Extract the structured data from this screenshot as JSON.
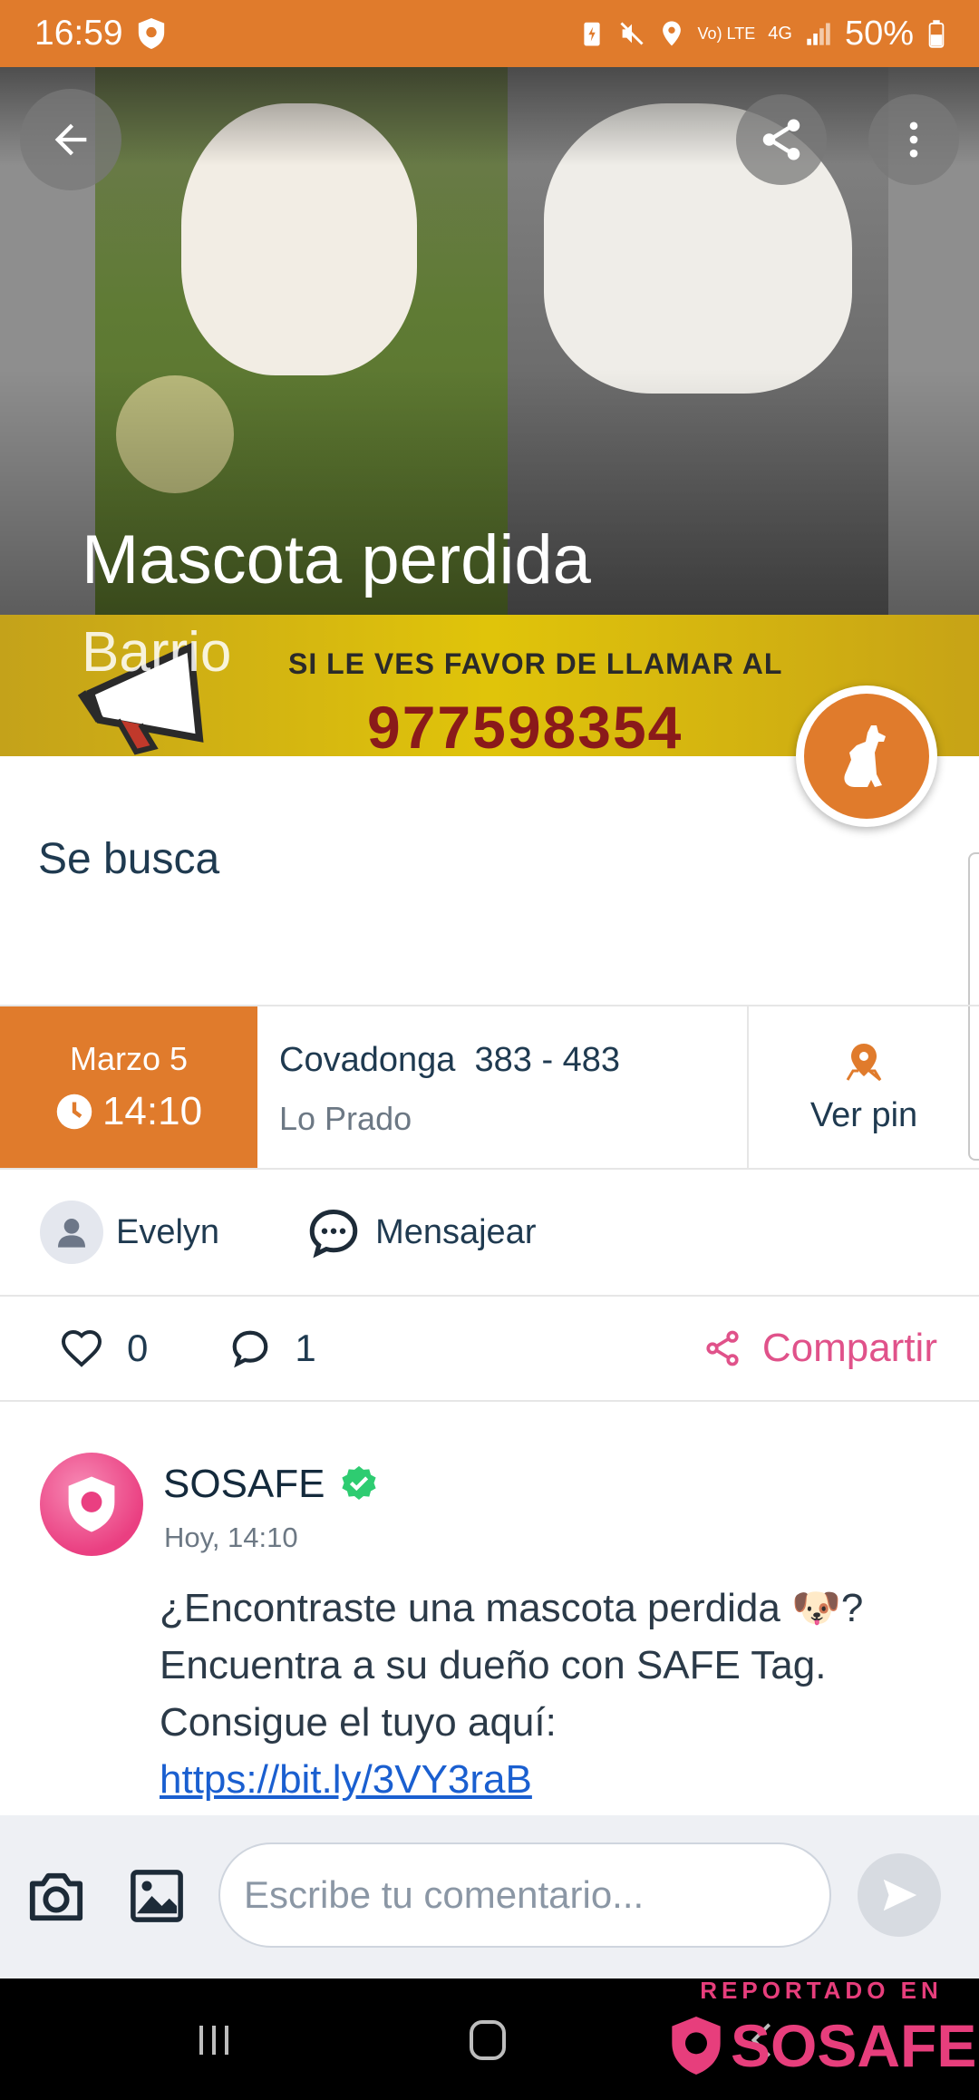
{
  "status_bar": {
    "time": "16:59",
    "battery": "50%",
    "network": "4G",
    "volte": "Vo) LTE"
  },
  "hero": {
    "title": "Mascota perdida",
    "subtitle": "Barrio",
    "banner_text": "SI LE VES FAVOR DE LLAMAR AL",
    "banner_phone": "977598354"
  },
  "post": {
    "description": "Se busca",
    "date": "Marzo 5",
    "time": "14:10",
    "street": "Covadonga  383 - 483",
    "commune": "Lo Prado",
    "pin_label": "Ver pin",
    "author": "Evelyn",
    "message_label": "Mensajear",
    "likes": "0",
    "comments": "1",
    "share_label": "Compartir"
  },
  "comment": {
    "author": "SOSAFE",
    "time": "Hoy, 14:10",
    "text": "¿Encontraste una mascota perdida 🐶? Encuentra a su dueño con SAFE Tag. Consigue el tuyo aquí: ",
    "link": "https://bit.ly/3VY3raB"
  },
  "composer": {
    "placeholder": "Escribe tu comentario..."
  },
  "watermark": {
    "top": "REPORTADO EN",
    "brand": "SOSAFE"
  },
  "colors": {
    "accent": "#e07b2c",
    "brand_pink": "#e73e7c",
    "link": "#1a5fd0"
  },
  "icons": [
    "back-arrow-icon",
    "share-icon",
    "more-vert-icon",
    "dog-icon",
    "clock-icon",
    "map-pin-icon",
    "person-icon",
    "chat-bubble-icon",
    "heart-icon",
    "comment-icon",
    "verified-icon",
    "camera-icon",
    "image-icon",
    "send-icon"
  ]
}
